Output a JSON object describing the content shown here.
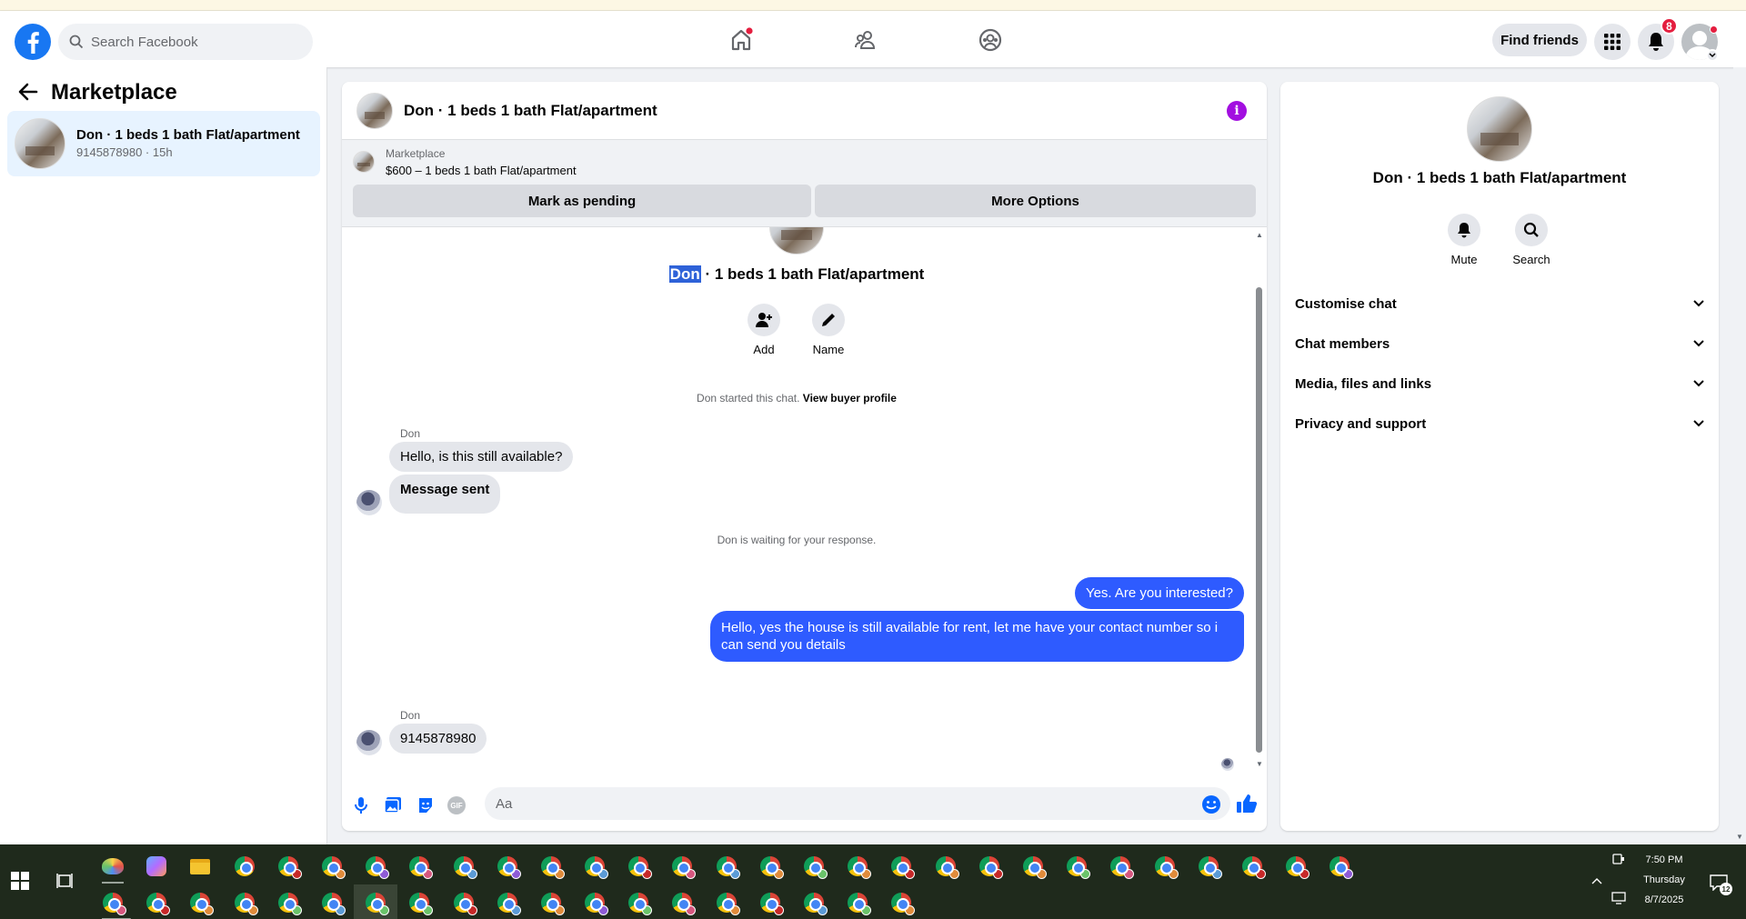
{
  "search": {
    "placeholder": "Search Facebook"
  },
  "topbar": {
    "find_friends": "Find friends",
    "notif_count": "8"
  },
  "left_panel": {
    "title": "Marketplace",
    "conversation": {
      "title": "Don · 1 beds 1 bath Flat/apartment",
      "subtitle": "9145878980 · 15h"
    }
  },
  "chat": {
    "header_title": "Don · 1 beds 1 bath Flat/apartment",
    "listing_source": "Marketplace",
    "listing_title": "$600 – 1 beds 1 bath Flat/apartment",
    "mark_pending": "Mark as pending",
    "more_options": "More Options",
    "intro_name_highlight": "Don",
    "intro_name_rest": " · 1 beds 1 bath Flat/apartment",
    "add_label": "Add",
    "name_label": "Name",
    "started_text": "Don started this chat.",
    "view_profile": "View buyer profile",
    "sender1": "Don",
    "msg1": "Hello, is this still available?",
    "msg2": "Message sent",
    "waiting_text": "Don is waiting for your response.",
    "out1": "Yes. Are you interested?",
    "out2": "Hello, yes the house is still available for rent, let me have your contact number so i can send you details",
    "sender2": "Don",
    "msg3": "9145878980",
    "composer_placeholder": "Aa"
  },
  "info_panel": {
    "title": "Don · 1 beds 1 bath Flat/apartment",
    "mute": "Mute",
    "search": "Search",
    "sections": [
      "Customise chat",
      "Chat members",
      "Media, files and links",
      "Privacy and support"
    ]
  },
  "taskbar": {
    "time": "7:50 PM",
    "day": "Thursday",
    "date": "8/7/2025",
    "notif_count": "12"
  },
  "colors": {
    "brand": "#1877f2",
    "outgoing_bubble": "#2e5bff",
    "info_icon": "#a20ee0"
  }
}
